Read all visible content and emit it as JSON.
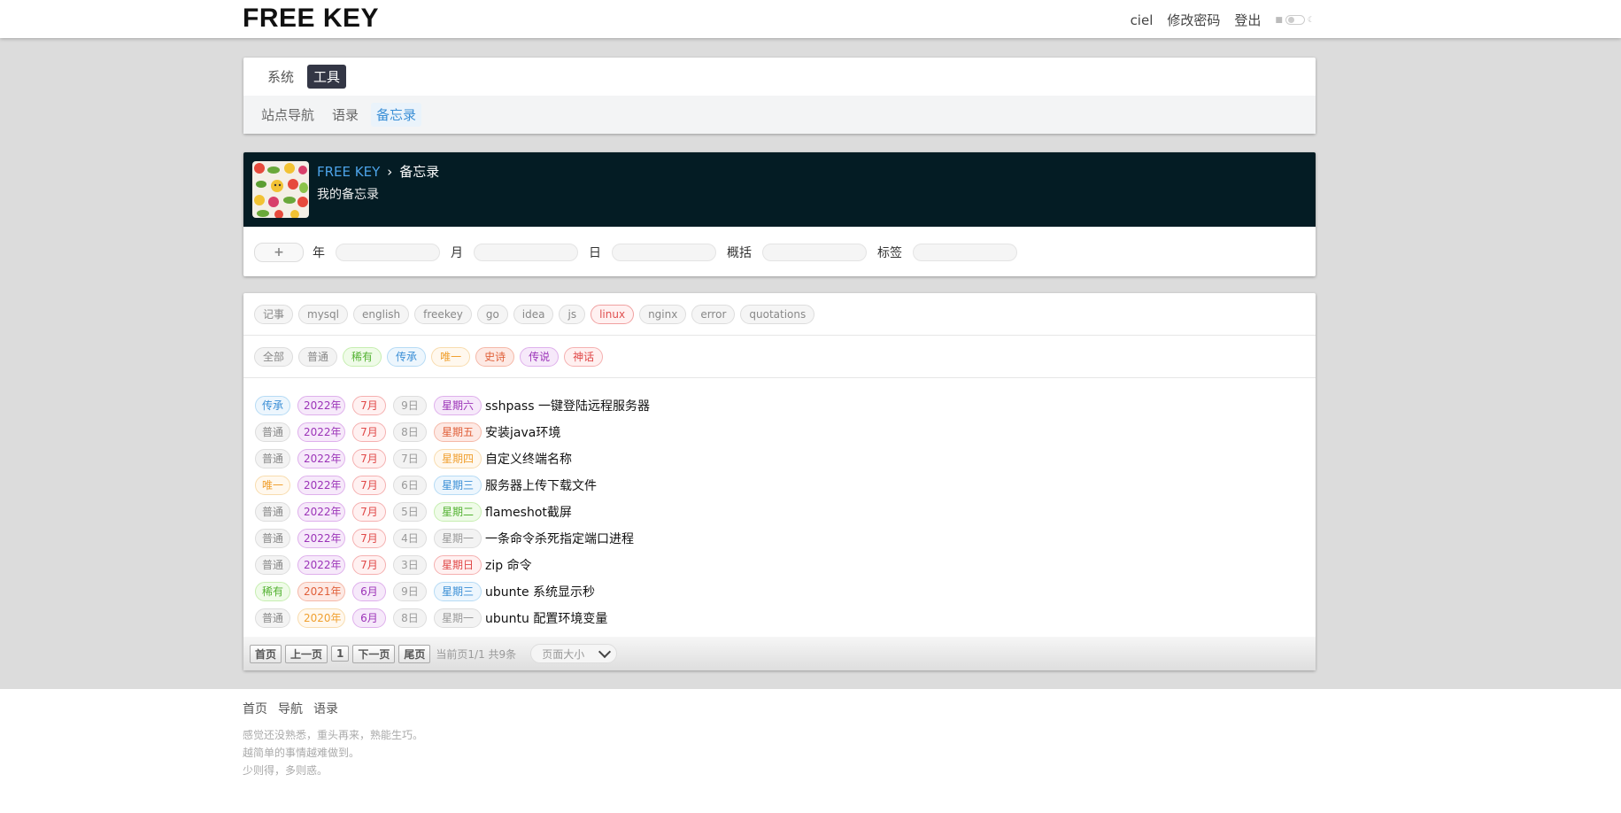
{
  "brand": {
    "logo": "FREE KEY"
  },
  "topnav": {
    "user": "ciel",
    "change_password": "修改密码",
    "logout": "登出"
  },
  "nav": {
    "tabs": [
      {
        "label": "系统"
      },
      {
        "label": "工具"
      }
    ],
    "sub_items": [
      {
        "label": "站点导航"
      },
      {
        "label": "语录"
      },
      {
        "label": "备忘录"
      }
    ]
  },
  "header": {
    "home": "FREE KEY",
    "separator": "›",
    "page": "备忘录",
    "description": "我的备忘录"
  },
  "filters": {
    "add": "+",
    "year": "年",
    "month": "月",
    "day": "日",
    "summary": "概括",
    "tag": "标签"
  },
  "tags": [
    "记事",
    "mysql",
    "english",
    "freekey",
    "go",
    "idea",
    "js",
    "linux",
    "nginx",
    "error",
    "quotations"
  ],
  "levels": [
    "全部",
    "普通",
    "稀有",
    "传承",
    "唯一",
    "史诗",
    "传说",
    "神话"
  ],
  "rows": [
    {
      "level": "传承",
      "year": "2022年",
      "month": "7月",
      "day": "9日",
      "weekday": "星期六",
      "title": "sshpass 一键登陆远程服务器"
    },
    {
      "level": "普通",
      "year": "2022年",
      "month": "7月",
      "day": "8日",
      "weekday": "星期五",
      "title": "安装java环境"
    },
    {
      "level": "普通",
      "year": "2022年",
      "month": "7月",
      "day": "7日",
      "weekday": "星期四",
      "title": "自定义终端名称"
    },
    {
      "level": "唯一",
      "year": "2022年",
      "month": "7月",
      "day": "6日",
      "weekday": "星期三",
      "title": "服务器上传下载文件"
    },
    {
      "level": "普通",
      "year": "2022年",
      "month": "7月",
      "day": "5日",
      "weekday": "星期二",
      "title": "flameshot截屏"
    },
    {
      "level": "普通",
      "year": "2022年",
      "month": "7月",
      "day": "4日",
      "weekday": "星期一",
      "title": "一条命令杀死指定端口进程"
    },
    {
      "level": "普通",
      "year": "2022年",
      "month": "7月",
      "day": "3日",
      "weekday": "星期日",
      "title": "zip 命令"
    },
    {
      "level": "稀有",
      "year": "2021年",
      "month": "6月",
      "day": "9日",
      "weekday": "星期三",
      "title": "ubunte 系统显示秒"
    },
    {
      "level": "普通",
      "year": "2020年",
      "month": "6月",
      "day": "8日",
      "weekday": "星期一",
      "title": "ubuntu 配置环境变量"
    }
  ],
  "pager": {
    "first": "首页",
    "prev": "上一页",
    "current": "1",
    "next": "下一页",
    "last": "尾页",
    "info": "当前页1/1 共9条",
    "page_size": "页面大小"
  },
  "footer": {
    "links": [
      "首页",
      "导航",
      "语录"
    ],
    "quotes": [
      "感觉还没熟悉，重头再来，熟能生巧。",
      "越简单的事情越难做到。",
      "少则得，多则惑。"
    ]
  }
}
